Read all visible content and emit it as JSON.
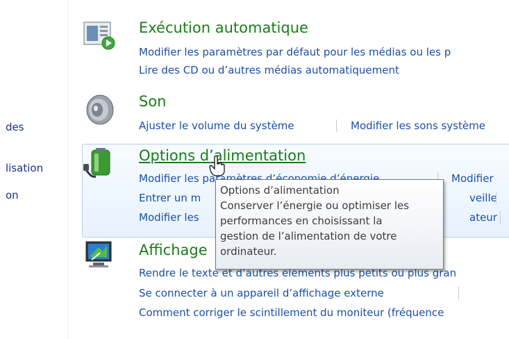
{
  "left_pane": {
    "items": [
      "des",
      "lisation",
      "on"
    ]
  },
  "categories": {
    "autoplay": {
      "title": "Exécution automatique",
      "links": [
        "Modifier les paramètres par défaut pour les médias ou les p",
        "Lire des CD ou d’autres médias automatiquement"
      ]
    },
    "sound": {
      "title": "Son",
      "links": [
        "Ajuster le volume du système",
        "Modifier les sons système"
      ]
    },
    "power": {
      "title": "Options d’alimentation",
      "links": [
        "Modifier les paramètres d’économie d’énergie",
        "Modifier",
        "Entrer un m",
        "veille",
        "Modifier les",
        "ateur"
      ]
    },
    "display": {
      "title": "Affichage",
      "links": [
        "Rendre le texte et d’autres éléments plus petits ou plus gran",
        "Se connecter à un appareil d’affichage externe",
        "Comment corriger le scintillement du moniteur (fréquence"
      ]
    }
  },
  "tooltip": {
    "lines": [
      "Options d’alimentation",
      "Conserver l’énergie ou optimiser les",
      "performances en choisissant la",
      "gestion de l’alimentation de votre",
      "ordinateur."
    ]
  },
  "colors": {
    "title_green": "#1b7b1b",
    "link_blue": "#1a4ea6",
    "highlight_border": "#b6cfee"
  }
}
